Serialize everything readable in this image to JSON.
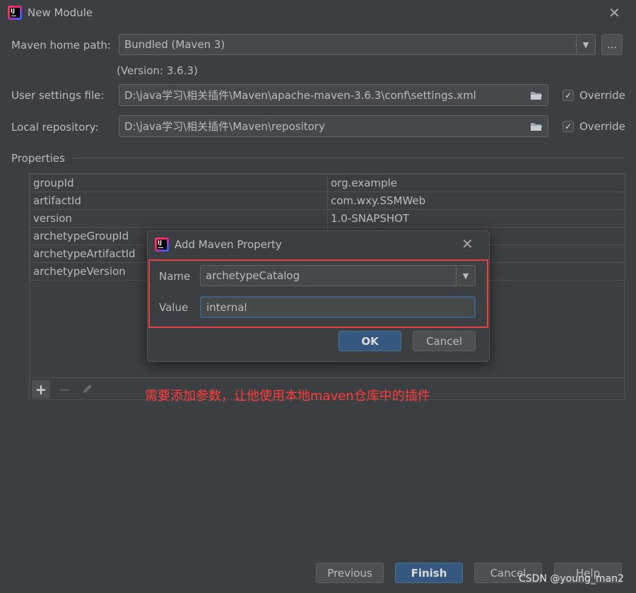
{
  "window": {
    "title": "New Module"
  },
  "maven": {
    "home_path_label": "Maven home path:",
    "home_path_value": "Bundled (Maven 3)",
    "browse_label": "...",
    "version_text": "(Version: 3.6.3)",
    "user_settings_label": "User settings file:",
    "user_settings_value": "D:\\java学习\\相关插件\\Maven\\apache-maven-3.6.3\\conf\\settings.xml",
    "local_repo_label": "Local repository:",
    "local_repo_value": "D:\\java学习\\相关插件\\Maven\\repository",
    "override_label": "Override",
    "override_checked": true
  },
  "properties": {
    "section_label": "Properties",
    "rows": [
      {
        "key": "groupId",
        "value": "org.example"
      },
      {
        "key": "artifactId",
        "value": "com.wxy.SSMWeb"
      },
      {
        "key": "version",
        "value": "1.0-SNAPSHOT"
      },
      {
        "key": "archetypeGroupId",
        "value": ""
      },
      {
        "key": "archetypeArtifactId",
        "value": ""
      },
      {
        "key": "archetypeVersion",
        "value": ""
      }
    ]
  },
  "dialog": {
    "title": "Add Maven Property",
    "name_label": "Name",
    "name_value": "archetypeCatalog",
    "value_label": "Value",
    "value_value": "internal",
    "ok_label": "OK",
    "cancel_label": "Cancel"
  },
  "annotation": {
    "text": "需要添加参数，让他使用本地maven仓库中的插件",
    "color": "#ff3b3b"
  },
  "footer": {
    "previous_label": "Previous",
    "finish_label": "Finish",
    "cancel_label": "Cancel",
    "help_label": "Help"
  },
  "watermark": {
    "text": "CSDN @young_man2"
  }
}
